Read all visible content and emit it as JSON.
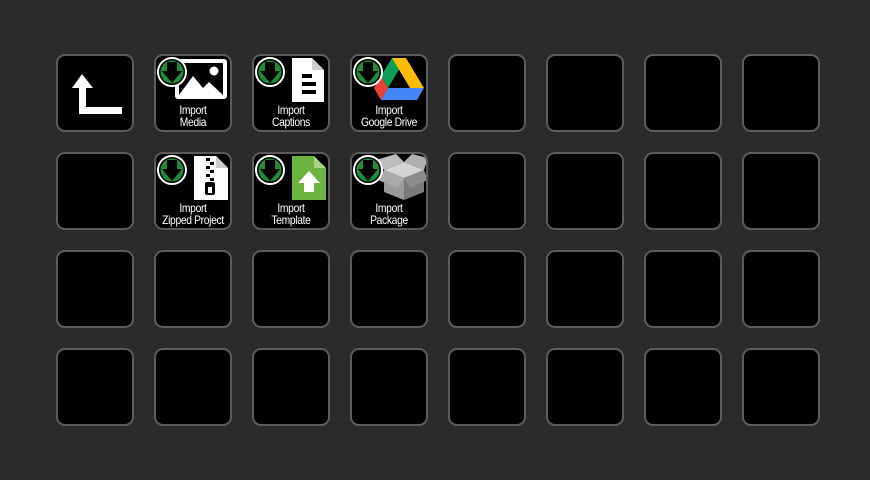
{
  "deck": {
    "columns": 8,
    "rows": 4,
    "keys": [
      {
        "id": "back",
        "icon": "back-arrow-icon"
      },
      {
        "id": "import-media",
        "icon": "image-icon",
        "badge": "download-arrow-icon",
        "label_line1": "Import",
        "label_line2": "Media"
      },
      {
        "id": "import-captions",
        "icon": "document-icon",
        "badge": "download-arrow-icon",
        "label_line1": "Import",
        "label_line2": "Captions"
      },
      {
        "id": "import-google-drive",
        "icon": "google-drive-icon",
        "badge": "download-arrow-icon",
        "label_line1": "Import",
        "label_line2": "Google Drive"
      },
      {
        "id": "import-zipped-project",
        "icon": "zip-file-icon",
        "badge": "download-arrow-icon",
        "label_line1": "Import",
        "label_line2": "Zipped Project"
      },
      {
        "id": "import-template",
        "icon": "template-file-icon",
        "badge": "download-arrow-icon",
        "label_line1": "Import",
        "label_line2": "Template"
      },
      {
        "id": "import-package",
        "icon": "package-box-icon",
        "badge": "download-arrow-icon",
        "label_line1": "Import",
        "label_line2": "Package"
      }
    ]
  },
  "colors": {
    "background": "#2b2b2b",
    "key_face": "#000000",
    "key_border": "#5c5c5c",
    "badge_green": "#1e8c3a",
    "template_green": "#6cb33f",
    "drive_yellow": "#fbbc04",
    "drive_green": "#0f9d58",
    "drive_blue": "#4285f4",
    "drive_red": "#ea4335"
  }
}
